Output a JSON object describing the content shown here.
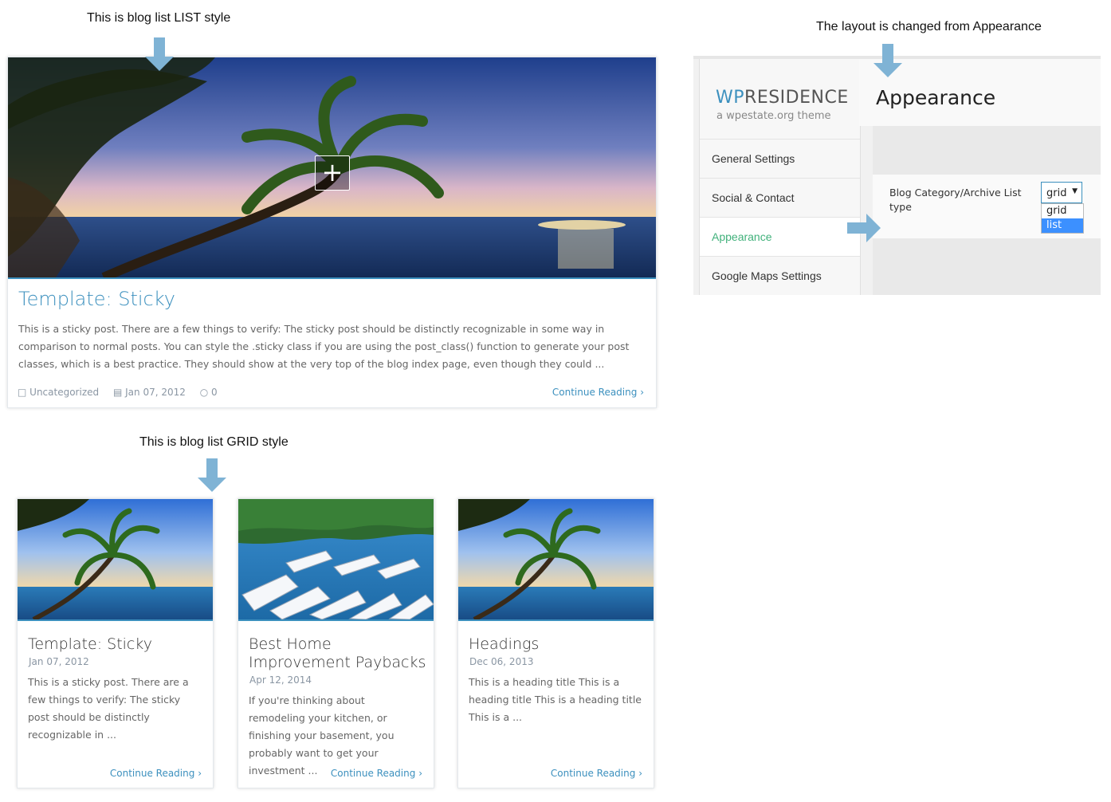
{
  "annotations": {
    "list_style": "This is blog list LIST style",
    "grid_style": "This is blog list GRID style",
    "layout_changed": "The layout is changed from Appearance"
  },
  "list_post": {
    "title": "Template: Sticky",
    "excerpt": "This is a sticky post. There are a few things to verify: The sticky post should be distinctly recognizable in some way in comparison to normal posts. You can style the .sticky class if you are using the post_class() function to generate your post classes, which is a best practice. They should show at the very top of the blog index page, even though they could ...",
    "category": "Uncategorized",
    "date": "Jan 07, 2012",
    "comments": "0",
    "continue": "Continue Reading",
    "plus_symbol": "+"
  },
  "grid_posts": [
    {
      "title": "Template: Sticky",
      "date": "Jan 07, 2012",
      "excerpt": "This is a sticky post. There are a few things to verify: The sticky post should be distinctly recognizable in ...",
      "continue": "Continue Reading"
    },
    {
      "title": "Best Home Improvement Paybacks",
      "date": "Apr 12, 2014",
      "excerpt": "If you're thinking about remodeling your kitchen, or finishing your basement, you probably want to get your investment ...",
      "continue": "Continue Reading"
    },
    {
      "title": "Headings",
      "date": "Dec 06, 2013",
      "excerpt": "This is a heading title This is a heading title This is a heading title This is a ...",
      "continue": "Continue Reading"
    }
  ],
  "admin": {
    "logo_wp": "WP",
    "logo_rest": "RESIDENCE",
    "tagline": "a wpestate.org theme",
    "page_title": "Appearance",
    "nav": [
      {
        "label": "General Settings"
      },
      {
        "label": "Social & Contact"
      },
      {
        "label": "Appearance"
      },
      {
        "label": "Google Maps Settings"
      }
    ],
    "option_label": "Blog Category/Archive List type",
    "select_value": "grid",
    "options": [
      "grid",
      "list"
    ]
  },
  "colors": {
    "accent_blue": "#3c90be",
    "active_green": "#41b17b",
    "arrow_blue": "#7fb3d5",
    "selected_option": "#3c90ff"
  }
}
